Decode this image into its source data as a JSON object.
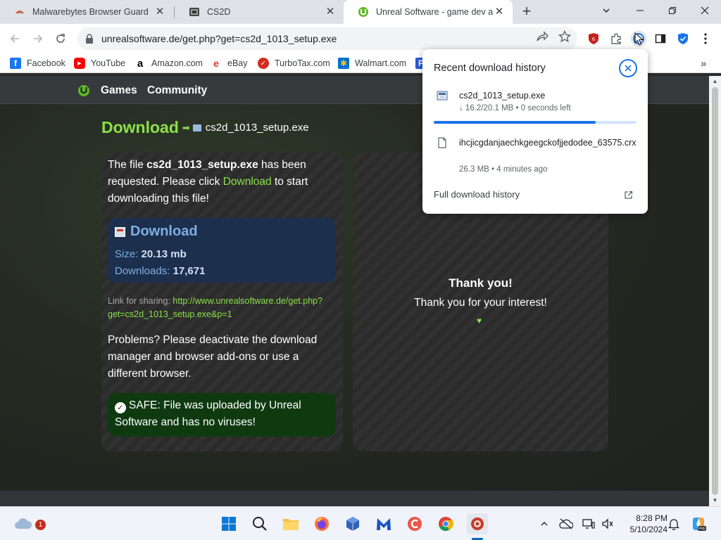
{
  "tabs": [
    {
      "title": "Malwarebytes Browser Guard",
      "close": "✕"
    },
    {
      "title": "CS2D",
      "close": "✕"
    },
    {
      "title": "Unreal Software - game dev and",
      "close": "✕"
    }
  ],
  "new_tab": "+",
  "address_bar": {
    "url": "unrealsoftware.de/get.php?get=cs2d_1013_setup.exe"
  },
  "bookmarks": [
    {
      "label": "Facebook",
      "icon": "f"
    },
    {
      "label": "YouTube",
      "icon": "▶"
    },
    {
      "label": "Amazon.com",
      "icon": "a"
    },
    {
      "label": "eBay",
      "icon": "e"
    },
    {
      "label": "TurboTax.com",
      "icon": "✓"
    },
    {
      "label": "Walmart.com",
      "icon": "✱"
    }
  ],
  "bookmarks_more": "»",
  "site_nav": {
    "games": "Games",
    "community": "Community"
  },
  "heading": {
    "title": "Download",
    "filename": "cs2d_1013_setup.exe"
  },
  "intro": {
    "prefix": "The file ",
    "filename": "cs2d_1013_setup.exe",
    "middle": " has been requested. Please click ",
    "link": "Download",
    "suffix": " to start downloading this file!"
  },
  "download_box": {
    "title": "Download",
    "size_label": "Size:",
    "size_value": "20.13 mb",
    "downloads_label": "Downloads:",
    "downloads_value": "17,671"
  },
  "share": {
    "label": "Link for sharing:",
    "url": "http://www.unrealsoftware.de/get.php?get=cs2d_1013_setup.exe&p=1"
  },
  "problems": "Problems? Please deactivate the download manager and browser add-ons or use a different browser.",
  "safe": "SAFE: File was uploaded by Unreal Software and has no viruses!",
  "thanks": {
    "title": "Thank you!",
    "text": "Thank you for your interest!"
  },
  "download_popup": {
    "title": "Recent download history",
    "items": [
      {
        "name": "cs2d_1013_setup.exe",
        "meta": "↓ 16.2/20.1 MB • 0 seconds left",
        "progress": 0.8
      },
      {
        "name": "ihcjicgdanjaechkgeegckofjjedodee_63575.crx",
        "meta": "26.3 MB • 4 minutes ago"
      }
    ],
    "full_history": "Full download history"
  },
  "taskbar": {
    "weather_badge": "1",
    "time": "8:28 PM",
    "date": "5/10/2024"
  },
  "colors": {
    "accent_green": "#8ce04a",
    "chrome_blue": "#1a73e8",
    "safe_green": "#0f3a10",
    "download_blue": "#1c2f4d"
  }
}
